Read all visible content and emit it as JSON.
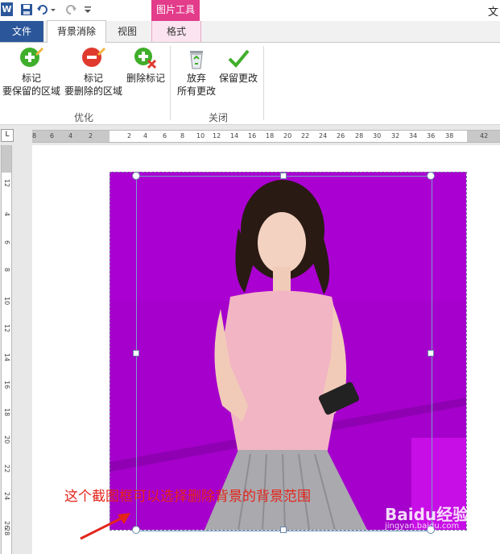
{
  "window": {
    "title": "文"
  },
  "qat": {
    "app_icon": "W"
  },
  "context_group": {
    "label": "图片工具"
  },
  "tabs": {
    "file": "文件",
    "background_removal": "背景消除",
    "view": "视图",
    "format": "格式"
  },
  "ribbon": {
    "mark_keep": {
      "line1": "标记",
      "line2": "要保留的区域",
      "icon": "plus-pencil-icon"
    },
    "mark_remove": {
      "line1": "标记",
      "line2": "要删除的区域",
      "icon": "minus-pencil-icon"
    },
    "delete_mark": {
      "line1": "删除标记",
      "icon": "delete-mark-icon"
    },
    "discard": {
      "line1": "放弃",
      "line2": "所有更改",
      "icon": "recycle-bin-icon"
    },
    "keep": {
      "line1": "保留更改",
      "icon": "checkmark-icon"
    },
    "group_optimize": "优化",
    "group_close": "关闭"
  },
  "ruler": {
    "horizontal_ticks": [
      "8",
      "6",
      "4",
      "2",
      "2",
      "4",
      "6",
      "8",
      "10",
      "12",
      "14",
      "16",
      "18",
      "20",
      "22",
      "24",
      "26",
      "28",
      "30",
      "32",
      "34",
      "36",
      "38",
      "42"
    ],
    "vertical_ticks": [
      "1",
      "2",
      "4",
      "6",
      "8",
      "10",
      "12",
      "14",
      "16",
      "18",
      "20",
      "22",
      "24",
      "26",
      "28"
    ]
  },
  "annotation": {
    "text": "这个截图框可以选择删除背景的背景范围"
  },
  "watermark": {
    "text": "Baidu经验",
    "sub": "jingyan.baidu.com"
  },
  "colors": {
    "file_tab": "#2b579a",
    "context_tab": "#e23c8b",
    "removal_overlay": "#a600cc",
    "annotation": "#e4241b"
  }
}
